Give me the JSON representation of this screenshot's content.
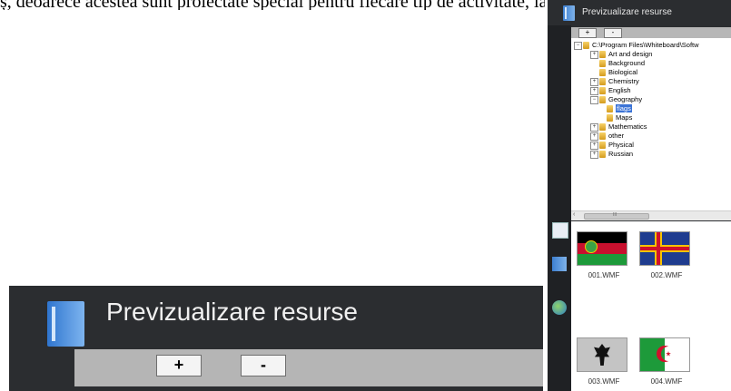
{
  "top_text": "ș, deoarece acestea sunt proiectate special pentru fiecare tip de activitate, iar fiecare grup",
  "panel": {
    "title": "Previzualizare resurse",
    "toolbar": {
      "plus": "+",
      "minus": "-"
    },
    "tree": [
      {
        "label": "C:\\Program Files\\Whiteboard\\Softw",
        "expander": "minus"
      },
      {
        "label": "Art and design",
        "expander": "plus"
      },
      {
        "label": "Background",
        "expander": "none"
      },
      {
        "label": "Biological",
        "expander": "none"
      },
      {
        "label": "Chemistry",
        "expander": "plus"
      },
      {
        "label": "English",
        "expander": "plus"
      },
      {
        "label": "Geography",
        "expander": "minus"
      },
      {
        "label": "flags",
        "expander": "none",
        "selected": true
      },
      {
        "label": "Maps",
        "expander": "none"
      },
      {
        "label": "Mathematics",
        "expander": "plus"
      },
      {
        "label": "other",
        "expander": "plus"
      },
      {
        "label": "Physical",
        "expander": "plus"
      },
      {
        "label": "Russian",
        "expander": "plus"
      }
    ],
    "thumbnails": [
      {
        "caption": "001.WMF",
        "icon": "flag-red-black-green-icon"
      },
      {
        "caption": "002.WMF",
        "icon": "flag-blue-red-cross-icon"
      },
      {
        "caption": "003.WMF",
        "icon": "flag-eagle-icon"
      },
      {
        "caption": "004.WMF",
        "icon": "flag-green-white-crescent-icon"
      }
    ],
    "scroll_mark": "III"
  },
  "enlarged": {
    "title": "Previzualizare resurse",
    "plus": "+",
    "minus": "-"
  }
}
